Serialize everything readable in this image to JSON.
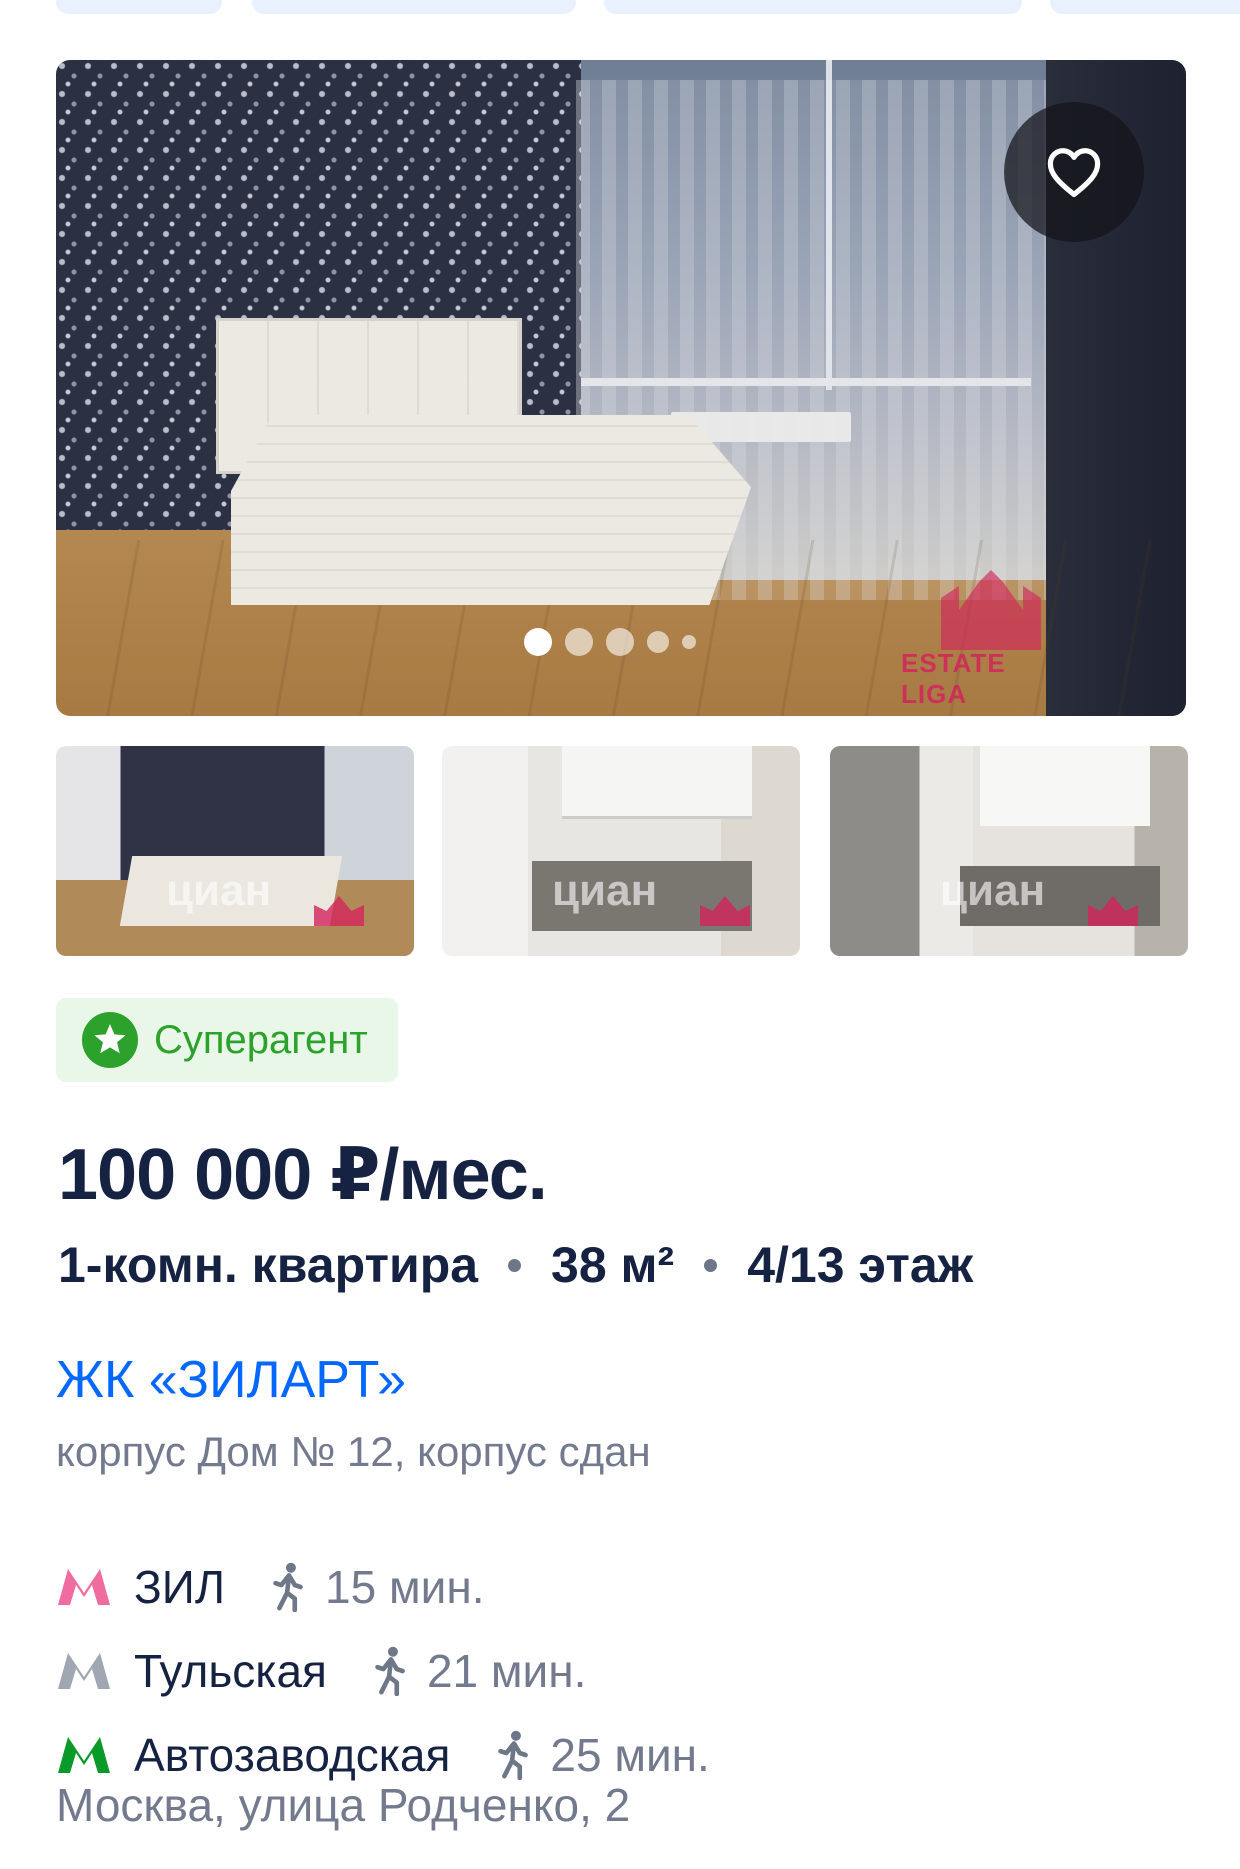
{
  "listing": {
    "badge": {
      "label": "Суперагент",
      "icon": "star-icon",
      "color": "#2ca12c"
    },
    "price": "100 000 ₽/мес.",
    "params": {
      "rooms": "1-комн. квартира",
      "area": "38 м²",
      "floor": "4/13 этаж"
    },
    "complex_name": "ЖК «ЗИЛАРТ»",
    "building_info": "корпус Дом № 12, корпус сдан",
    "metro": [
      {
        "name": "ЗИЛ",
        "line_color": "#f06ca0",
        "walk": "15 мин."
      },
      {
        "name": "Тульская",
        "line_color": "#a1a6b3",
        "walk": "21 мин."
      },
      {
        "name": "Автозаводская",
        "line_color": "#0a9a2a",
        "walk": "25 мин."
      }
    ],
    "address": "Москва, улица Родченко, 2"
  },
  "gallery": {
    "current_index": 1,
    "dots": 5,
    "watermark": "ESTATE LIGA",
    "thumb_watermark": "циан"
  },
  "colors": {
    "link": "#0468ff",
    "primary_text": "#152242",
    "secondary_text": "#737a8e"
  }
}
